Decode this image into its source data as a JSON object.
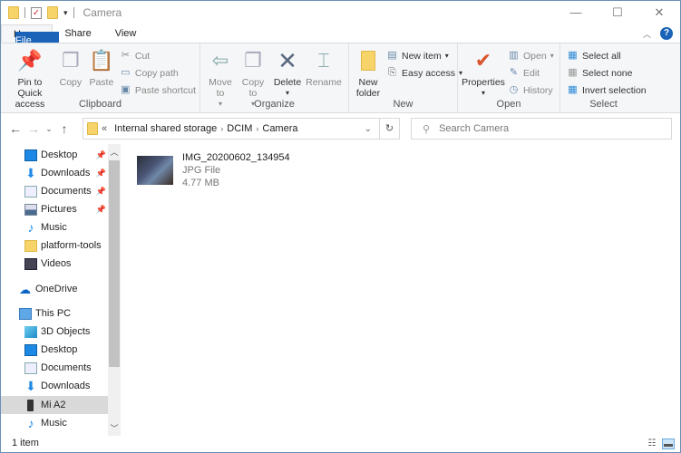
{
  "window": {
    "title": "Camera",
    "minimize": "—",
    "maximize": "☐",
    "close": "✕"
  },
  "tabs": [
    {
      "label": "File"
    },
    {
      "label": "Home"
    },
    {
      "label": "Share"
    },
    {
      "label": "View"
    }
  ],
  "ribbon": {
    "clipboard": {
      "label": "Clipboard",
      "pin": "Pin to Quick access",
      "copy": "Copy",
      "paste": "Paste",
      "cut": "Cut",
      "copy_path": "Copy path",
      "paste_shortcut": "Paste shortcut"
    },
    "organize": {
      "label": "Organize",
      "move_to": "Move to",
      "copy_to": "Copy to",
      "delete": "Delete",
      "rename": "Rename"
    },
    "new": {
      "label": "New",
      "new_folder": "New folder",
      "new_item": "New item",
      "easy_access": "Easy access"
    },
    "open": {
      "label": "Open",
      "properties": "Properties",
      "open": "Open",
      "edit": "Edit",
      "history": "History"
    },
    "select": {
      "label": "Select",
      "select_all": "Select all",
      "select_none": "Select none",
      "invert": "Invert selection"
    }
  },
  "address": {
    "overflow": "«",
    "crumbs": [
      "Internal shared storage",
      "DCIM",
      "Camera"
    ],
    "search_placeholder": "Search Camera"
  },
  "sidebar": {
    "items": [
      {
        "label": "Desktop",
        "pinned": true,
        "icon": "desktop-icon"
      },
      {
        "label": "Downloads",
        "pinned": true,
        "icon": "downloads-icon"
      },
      {
        "label": "Documents",
        "pinned": true,
        "icon": "documents-icon"
      },
      {
        "label": "Pictures",
        "pinned": true,
        "icon": "pictures-icon"
      },
      {
        "label": "Music",
        "pinned": false,
        "icon": "music-icon"
      },
      {
        "label": "platform-tools",
        "pinned": false,
        "icon": "folder-icon"
      },
      {
        "label": "Videos",
        "pinned": false,
        "icon": "videos-icon"
      },
      {
        "label": "OneDrive",
        "icon": "onedrive-icon"
      },
      {
        "label": "This PC",
        "icon": "this-pc-icon"
      },
      {
        "label": "3D Objects",
        "icon": "3d-objects-icon"
      },
      {
        "label": "Desktop",
        "icon": "desktop-icon"
      },
      {
        "label": "Documents",
        "icon": "documents-icon"
      },
      {
        "label": "Downloads",
        "icon": "downloads-icon"
      },
      {
        "label": "Mi A2",
        "icon": "phone-icon",
        "selected": true
      },
      {
        "label": "Music",
        "icon": "music-icon"
      }
    ]
  },
  "files": [
    {
      "name": "IMG_20200602_134954",
      "type": "JPG File",
      "size": "4.77 MB"
    }
  ],
  "status": {
    "count": "1 item"
  }
}
